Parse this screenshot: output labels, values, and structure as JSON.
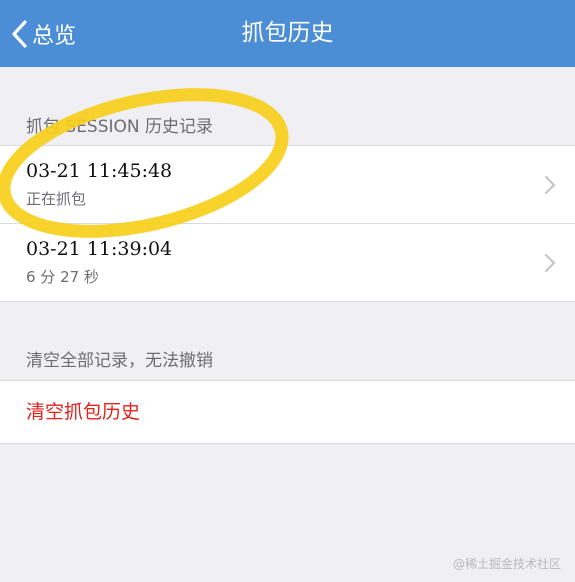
{
  "navbar": {
    "back_label": "总览",
    "title": "抓包历史"
  },
  "history_section": {
    "header": "抓包 SESSION 历史记录",
    "items": [
      {
        "time": "03-21 11:45:48",
        "status": "正在抓包"
      },
      {
        "time": "03-21 11:39:04",
        "status": "6 分 27 秒"
      }
    ]
  },
  "clear_section": {
    "header": "清空全部记录，无法撤销",
    "action_label": "清空抓包历史"
  },
  "watermark": "@稀土掘金技术社区",
  "colors": {
    "navbar": "#4b8ed6",
    "background": "#efeff4",
    "destructive": "#e0231d",
    "highlight": "#f7cf1a"
  }
}
